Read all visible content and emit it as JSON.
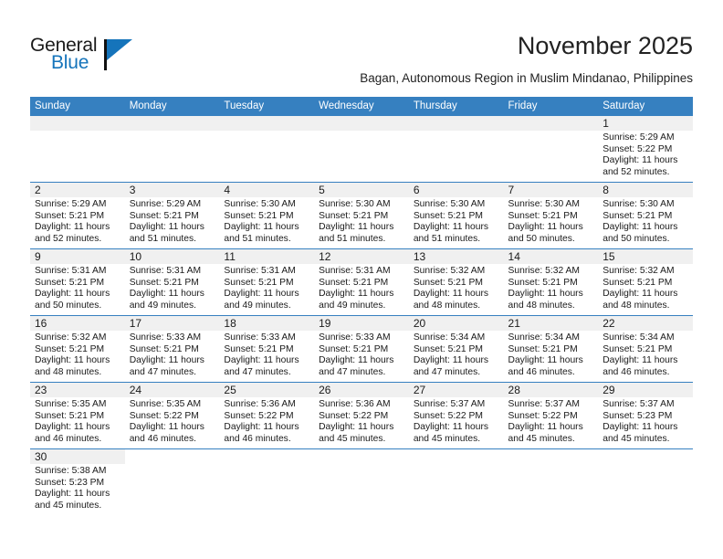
{
  "brand": {
    "logo_primary": "General",
    "logo_secondary": "Blue",
    "accent_color": "#1574bb"
  },
  "header": {
    "title": "November 2025",
    "subtitle": "Bagan, Autonomous Region in Muslim Mindanao, Philippines"
  },
  "calendar": {
    "header_bg": "#3680c0",
    "daynum_bg": "#f0f0f0",
    "weekday_headers": [
      "Sunday",
      "Monday",
      "Tuesday",
      "Wednesday",
      "Thursday",
      "Friday",
      "Saturday"
    ],
    "weeks": [
      [
        {
          "day": "",
          "lines": []
        },
        {
          "day": "",
          "lines": []
        },
        {
          "day": "",
          "lines": []
        },
        {
          "day": "",
          "lines": []
        },
        {
          "day": "",
          "lines": []
        },
        {
          "day": "",
          "lines": []
        },
        {
          "day": "1",
          "lines": [
            "Sunrise: 5:29 AM",
            "Sunset: 5:22 PM",
            "Daylight: 11 hours",
            "and 52 minutes."
          ]
        }
      ],
      [
        {
          "day": "2",
          "lines": [
            "Sunrise: 5:29 AM",
            "Sunset: 5:21 PM",
            "Daylight: 11 hours",
            "and 52 minutes."
          ]
        },
        {
          "day": "3",
          "lines": [
            "Sunrise: 5:29 AM",
            "Sunset: 5:21 PM",
            "Daylight: 11 hours",
            "and 51 minutes."
          ]
        },
        {
          "day": "4",
          "lines": [
            "Sunrise: 5:30 AM",
            "Sunset: 5:21 PM",
            "Daylight: 11 hours",
            "and 51 minutes."
          ]
        },
        {
          "day": "5",
          "lines": [
            "Sunrise: 5:30 AM",
            "Sunset: 5:21 PM",
            "Daylight: 11 hours",
            "and 51 minutes."
          ]
        },
        {
          "day": "6",
          "lines": [
            "Sunrise: 5:30 AM",
            "Sunset: 5:21 PM",
            "Daylight: 11 hours",
            "and 51 minutes."
          ]
        },
        {
          "day": "7",
          "lines": [
            "Sunrise: 5:30 AM",
            "Sunset: 5:21 PM",
            "Daylight: 11 hours",
            "and 50 minutes."
          ]
        },
        {
          "day": "8",
          "lines": [
            "Sunrise: 5:30 AM",
            "Sunset: 5:21 PM",
            "Daylight: 11 hours",
            "and 50 minutes."
          ]
        }
      ],
      [
        {
          "day": "9",
          "lines": [
            "Sunrise: 5:31 AM",
            "Sunset: 5:21 PM",
            "Daylight: 11 hours",
            "and 50 minutes."
          ]
        },
        {
          "day": "10",
          "lines": [
            "Sunrise: 5:31 AM",
            "Sunset: 5:21 PM",
            "Daylight: 11 hours",
            "and 49 minutes."
          ]
        },
        {
          "day": "11",
          "lines": [
            "Sunrise: 5:31 AM",
            "Sunset: 5:21 PM",
            "Daylight: 11 hours",
            "and 49 minutes."
          ]
        },
        {
          "day": "12",
          "lines": [
            "Sunrise: 5:31 AM",
            "Sunset: 5:21 PM",
            "Daylight: 11 hours",
            "and 49 minutes."
          ]
        },
        {
          "day": "13",
          "lines": [
            "Sunrise: 5:32 AM",
            "Sunset: 5:21 PM",
            "Daylight: 11 hours",
            "and 48 minutes."
          ]
        },
        {
          "day": "14",
          "lines": [
            "Sunrise: 5:32 AM",
            "Sunset: 5:21 PM",
            "Daylight: 11 hours",
            "and 48 minutes."
          ]
        },
        {
          "day": "15",
          "lines": [
            "Sunrise: 5:32 AM",
            "Sunset: 5:21 PM",
            "Daylight: 11 hours",
            "and 48 minutes."
          ]
        }
      ],
      [
        {
          "day": "16",
          "lines": [
            "Sunrise: 5:32 AM",
            "Sunset: 5:21 PM",
            "Daylight: 11 hours",
            "and 48 minutes."
          ]
        },
        {
          "day": "17",
          "lines": [
            "Sunrise: 5:33 AM",
            "Sunset: 5:21 PM",
            "Daylight: 11 hours",
            "and 47 minutes."
          ]
        },
        {
          "day": "18",
          "lines": [
            "Sunrise: 5:33 AM",
            "Sunset: 5:21 PM",
            "Daylight: 11 hours",
            "and 47 minutes."
          ]
        },
        {
          "day": "19",
          "lines": [
            "Sunrise: 5:33 AM",
            "Sunset: 5:21 PM",
            "Daylight: 11 hours",
            "and 47 minutes."
          ]
        },
        {
          "day": "20",
          "lines": [
            "Sunrise: 5:34 AM",
            "Sunset: 5:21 PM",
            "Daylight: 11 hours",
            "and 47 minutes."
          ]
        },
        {
          "day": "21",
          "lines": [
            "Sunrise: 5:34 AM",
            "Sunset: 5:21 PM",
            "Daylight: 11 hours",
            "and 46 minutes."
          ]
        },
        {
          "day": "22",
          "lines": [
            "Sunrise: 5:34 AM",
            "Sunset: 5:21 PM",
            "Daylight: 11 hours",
            "and 46 minutes."
          ]
        }
      ],
      [
        {
          "day": "23",
          "lines": [
            "Sunrise: 5:35 AM",
            "Sunset: 5:21 PM",
            "Daylight: 11 hours",
            "and 46 minutes."
          ]
        },
        {
          "day": "24",
          "lines": [
            "Sunrise: 5:35 AM",
            "Sunset: 5:22 PM",
            "Daylight: 11 hours",
            "and 46 minutes."
          ]
        },
        {
          "day": "25",
          "lines": [
            "Sunrise: 5:36 AM",
            "Sunset: 5:22 PM",
            "Daylight: 11 hours",
            "and 46 minutes."
          ]
        },
        {
          "day": "26",
          "lines": [
            "Sunrise: 5:36 AM",
            "Sunset: 5:22 PM",
            "Daylight: 11 hours",
            "and 45 minutes."
          ]
        },
        {
          "day": "27",
          "lines": [
            "Sunrise: 5:37 AM",
            "Sunset: 5:22 PM",
            "Daylight: 11 hours",
            "and 45 minutes."
          ]
        },
        {
          "day": "28",
          "lines": [
            "Sunrise: 5:37 AM",
            "Sunset: 5:22 PM",
            "Daylight: 11 hours",
            "and 45 minutes."
          ]
        },
        {
          "day": "29",
          "lines": [
            "Sunrise: 5:37 AM",
            "Sunset: 5:23 PM",
            "Daylight: 11 hours",
            "and 45 minutes."
          ]
        }
      ],
      [
        {
          "day": "30",
          "lines": [
            "Sunrise: 5:38 AM",
            "Sunset: 5:23 PM",
            "Daylight: 11 hours",
            "and 45 minutes."
          ]
        },
        {
          "day": "",
          "lines": []
        },
        {
          "day": "",
          "lines": []
        },
        {
          "day": "",
          "lines": []
        },
        {
          "day": "",
          "lines": []
        },
        {
          "day": "",
          "lines": []
        },
        {
          "day": "",
          "lines": []
        }
      ]
    ]
  }
}
